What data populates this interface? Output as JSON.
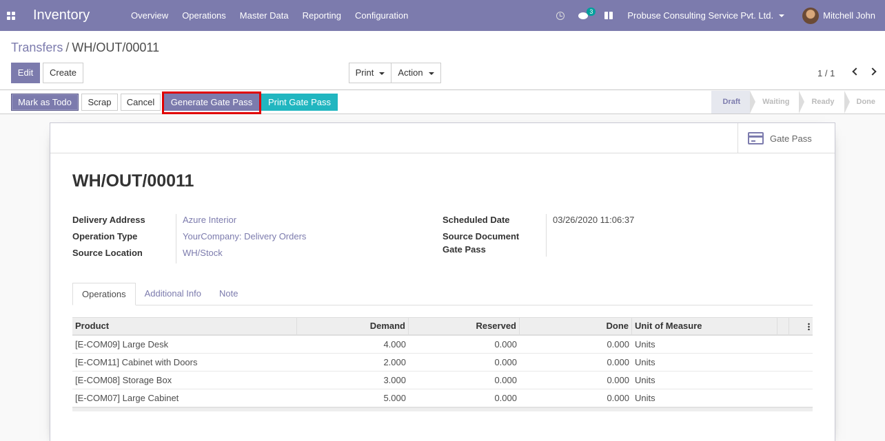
{
  "navbar": {
    "brand": "Inventory",
    "menu": [
      "Overview",
      "Operations",
      "Master Data",
      "Reporting",
      "Configuration"
    ],
    "chat_count": "3",
    "company": "Probuse Consulting Service Pvt. Ltd.",
    "user": "Mitchell John"
  },
  "breadcrumb": {
    "parent": "Transfers",
    "separator": "/",
    "current": "WH/OUT/00011"
  },
  "control": {
    "edit": "Edit",
    "create": "Create",
    "print": "Print",
    "action": "Action",
    "pager": "1 / 1"
  },
  "statusbar": {
    "buttons": {
      "todo": "Mark as Todo",
      "scrap": "Scrap",
      "cancel": "Cancel",
      "generate": "Generate Gate Pass",
      "print_gate": "Print Gate Pass"
    },
    "stages": [
      "Draft",
      "Waiting",
      "Ready",
      "Done"
    ],
    "active_stage": "Draft"
  },
  "sheet": {
    "smart_button": "Gate Pass",
    "title": "WH/OUT/00011",
    "left_fields": [
      {
        "label": "Delivery Address",
        "value": "Azure Interior"
      },
      {
        "label": "Operation Type",
        "value": "YourCompany: Delivery Orders"
      },
      {
        "label": "Source Location",
        "value": "WH/Stock"
      }
    ],
    "right_fields": [
      {
        "label": "Scheduled Date",
        "value": "03/26/2020 11:06:37"
      },
      {
        "label": "Source Document",
        "value": ""
      },
      {
        "label": "Gate Pass",
        "value": ""
      }
    ],
    "tabs": [
      "Operations",
      "Additional Info",
      "Note"
    ],
    "table": {
      "headers": [
        "Product",
        "Demand",
        "Reserved",
        "Done",
        "Unit of Measure"
      ],
      "rows": [
        [
          "[E-COM09] Large Desk",
          "4.000",
          "0.000",
          "0.000",
          "Units"
        ],
        [
          "[E-COM11] Cabinet with Doors",
          "2.000",
          "0.000",
          "0.000",
          "Units"
        ],
        [
          "[E-COM08] Storage Box",
          "3.000",
          "0.000",
          "0.000",
          "Units"
        ],
        [
          "[E-COM07] Large Cabinet",
          "5.000",
          "0.000",
          "0.000",
          "Units"
        ]
      ]
    }
  },
  "colors": {
    "primary": "#7c7bad",
    "teal": "#21b6c0",
    "highlight": "#e00000"
  }
}
